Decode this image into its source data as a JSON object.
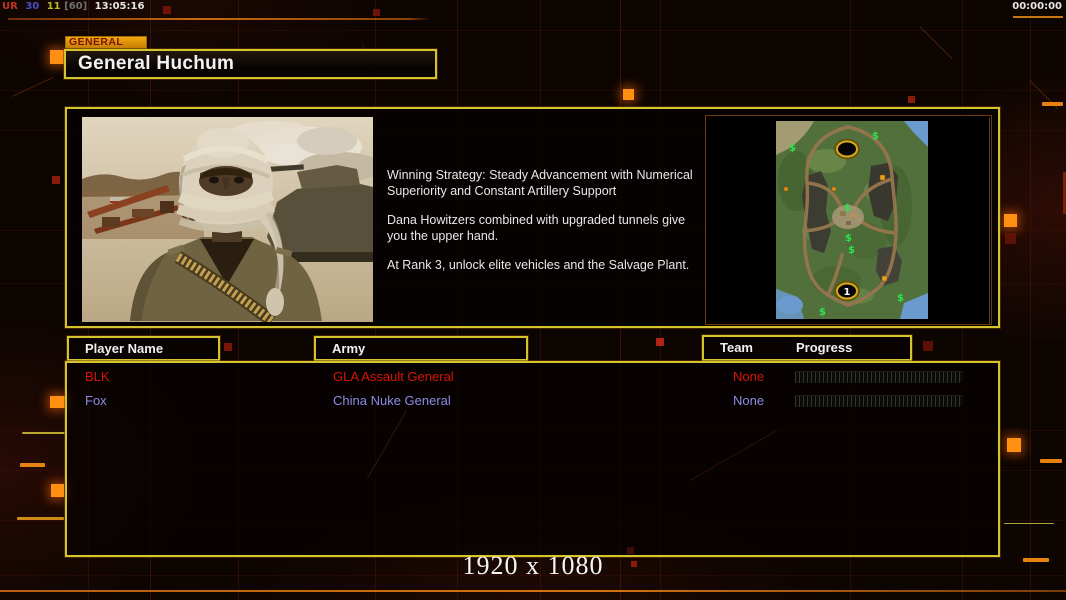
{
  "status_bar": {
    "segments": [
      {
        "text": "UR",
        "style": "color:#c23122"
      },
      {
        "text": "30",
        "style": "color:#4d4dc9"
      },
      {
        "text": "11",
        "style": "color:#b9b922"
      },
      {
        "text": "[60]",
        "style": "color:#6f6f6f"
      },
      {
        "text": "13:05:16",
        "style": "color:#e6e6e6"
      }
    ],
    "elapsed_time": "00:00:00"
  },
  "header": {
    "tab_label": "GENERAL",
    "title": "General Huchum"
  },
  "briefing": {
    "lines": [
      "Winning Strategy: Steady Advancement with Numerical Superiority and Constant Artillery Support",
      "Dana Howitzers combined with upgraded tunnels give you the upper hand.",
      "At Rank 3, unlock elite vehicles and the Salvage Plant."
    ]
  },
  "minimap": {
    "supply_symbol": "$",
    "start_marker_bottom": "1"
  },
  "players_table": {
    "columns": [
      "Player Name",
      "Army",
      "Team",
      "Progress"
    ],
    "rows": [
      {
        "name": "BLK",
        "army": "GLA Assault General",
        "team": "None",
        "style": "color:#d51506",
        "progress_percent": 0
      },
      {
        "name": "Fox",
        "army": "China Nuke General",
        "team": "None",
        "style": "color:#8b8be4",
        "progress_percent": 0
      }
    ]
  },
  "footer": {
    "resolution_label": "1920 x 1080"
  },
  "colors": {
    "accent_yellow": "#d4c52e",
    "accent_orange": "#ff9012",
    "tab_orange": "#e89a08",
    "player1_red": "#d51506",
    "player2_blue": "#8b8be4"
  }
}
